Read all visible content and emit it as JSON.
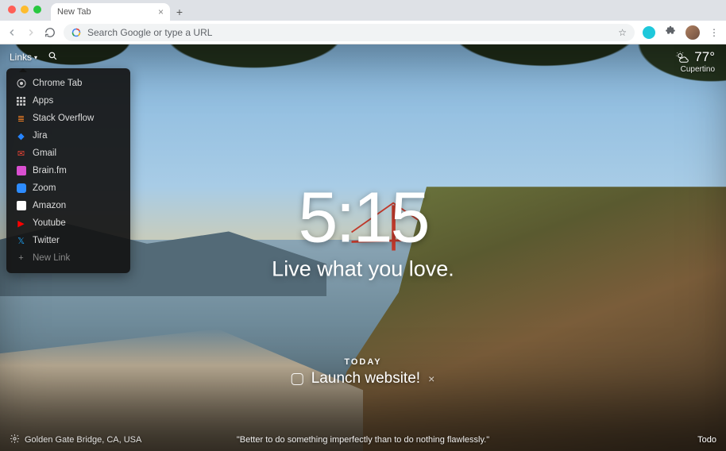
{
  "browser": {
    "tab_title": "New Tab",
    "omnibox_placeholder": "Search Google or type a URL"
  },
  "topbar": {
    "links_label": "Links"
  },
  "links_menu": {
    "items": [
      {
        "label": "Chrome Tab",
        "icon": "chrome-icon",
        "color": "#ddd"
      },
      {
        "label": "Apps",
        "icon": "apps-grid-icon",
        "color": "#ddd"
      },
      {
        "label": "Stack Overflow",
        "icon": "stackoverflow-icon",
        "color": "#f48024"
      },
      {
        "label": "Jira",
        "icon": "jira-icon",
        "color": "#2684ff"
      },
      {
        "label": "Gmail",
        "icon": "gmail-icon",
        "color": "#ea4335"
      },
      {
        "label": "Brain.fm",
        "icon": "brainfm-icon",
        "color": "#d94fd0"
      },
      {
        "label": "Zoom",
        "icon": "zoom-icon",
        "color": "#2d8cff"
      },
      {
        "label": "Amazon",
        "icon": "amazon-icon",
        "color": "#fff"
      },
      {
        "label": "Youtube",
        "icon": "youtube-icon",
        "color": "#ff0000"
      },
      {
        "label": "Twitter",
        "icon": "twitter-icon",
        "color": "#1da1f2"
      }
    ],
    "new_link_label": "New Link"
  },
  "weather": {
    "temp": "77°",
    "location": "Cupertino"
  },
  "center": {
    "time": "5:15",
    "mantra": "Live what you love."
  },
  "focus": {
    "label": "TODAY",
    "task": "Launch website!"
  },
  "bottom": {
    "photo_credit": "Golden Gate Bridge, CA, USA",
    "quote": "\"Better to do something imperfectly than to do nothing flawlessly.\"",
    "todo_label": "Todo"
  }
}
